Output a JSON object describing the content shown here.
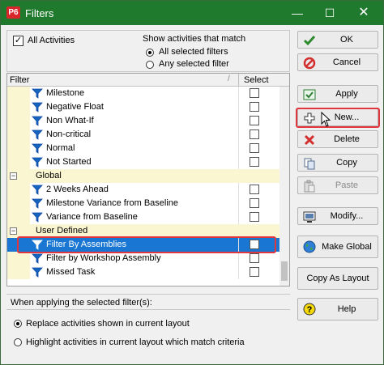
{
  "window": {
    "app_icon": "P6",
    "title": "Filters"
  },
  "title_controls": {
    "minimize": "—",
    "maximize": "☐",
    "close": "✕"
  },
  "top": {
    "all_activities": {
      "label": "All Activities",
      "checked": true
    },
    "match_heading": "Show activities that match",
    "options": [
      {
        "label": "All selected filters",
        "selected": true
      },
      {
        "label": "Any selected filter",
        "selected": false
      }
    ]
  },
  "grid": {
    "columns": {
      "filter": "Filter",
      "select": "Select",
      "sort_glyph": "/"
    },
    "rows": [
      {
        "name": "Milestone",
        "kind": "filter"
      },
      {
        "name": "Negative Float",
        "kind": "filter"
      },
      {
        "name": "Non What-If",
        "kind": "filter"
      },
      {
        "name": "Non-critical",
        "kind": "filter"
      },
      {
        "name": "Normal",
        "kind": "filter"
      },
      {
        "name": "Not Started",
        "kind": "filter"
      },
      {
        "name": "Global",
        "kind": "group"
      },
      {
        "name": "2 Weeks Ahead",
        "kind": "filter"
      },
      {
        "name": "Milestone Variance from Baseline",
        "kind": "filter"
      },
      {
        "name": "Variance from Baseline",
        "kind": "filter"
      },
      {
        "name": "User Defined",
        "kind": "group"
      },
      {
        "name": "Filter By Assemblies",
        "kind": "filter",
        "selected": true
      },
      {
        "name": "Filter by Workshop Assembly",
        "kind": "filter"
      },
      {
        "name": "Missed Task",
        "kind": "filter"
      }
    ]
  },
  "bottom": {
    "heading": "When applying the selected filter(s):",
    "options": [
      {
        "label": "Replace activities shown in current layout",
        "selected": true
      },
      {
        "label": "Highlight activities in current layout which match criteria",
        "selected": false
      }
    ]
  },
  "buttons": {
    "ok": "OK",
    "cancel": "Cancel",
    "apply": "Apply",
    "new": "New...",
    "delete": "Delete",
    "copy": "Copy",
    "paste": "Paste",
    "modify": "Modify...",
    "make_global": "Make Global",
    "copy_as_layout": "Copy As Layout",
    "help": "Help"
  },
  "colors": {
    "titlebar": "#1f7a2e",
    "selection": "#1976d2",
    "highlight": "#e0373f",
    "group_band": "#fbf6d2",
    "funnel": "#1565c0"
  }
}
